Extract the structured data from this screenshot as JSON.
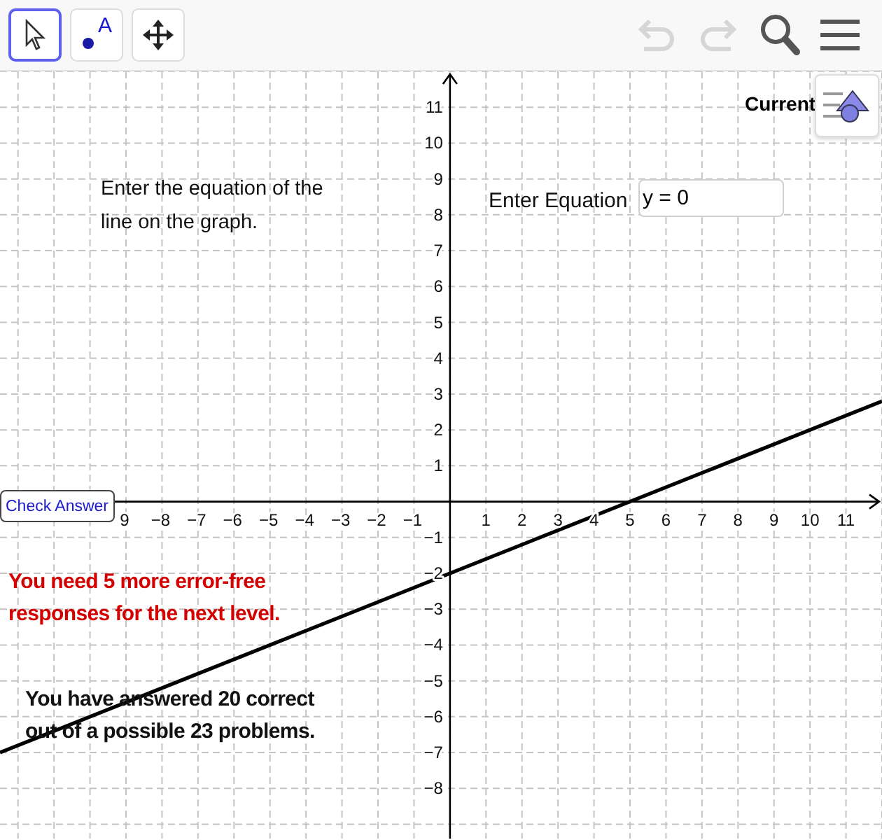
{
  "toolbar": {
    "tools": [
      {
        "kind": "pointer",
        "selected": true
      },
      {
        "kind": "point",
        "label": "A",
        "selected": false
      },
      {
        "kind": "move",
        "selected": false
      }
    ],
    "actions": [
      {
        "kind": "undo",
        "disabled": true
      },
      {
        "kind": "redo",
        "disabled": true
      },
      {
        "kind": "search",
        "disabled": false
      },
      {
        "kind": "menu",
        "disabled": false
      }
    ]
  },
  "graph": {
    "chart_data": {
      "type": "line",
      "grid": true,
      "x": [
        -12.5,
        12
      ],
      "series": [
        {
          "color": "#000000",
          "values": [
            -7,
            2.8
          ]
        }
      ],
      "xlim": [
        -12.5,
        12
      ],
      "ylim": [
        -9.4,
        12
      ],
      "xticks": [
        {
          "value": -9,
          "label": "9"
        },
        {
          "value": -8,
          "label": "−8"
        },
        {
          "value": -7,
          "label": "−7"
        },
        {
          "value": -6,
          "label": "−6"
        },
        {
          "value": -5,
          "label": "−5"
        },
        {
          "value": -4,
          "label": "−4"
        },
        {
          "value": -3,
          "label": "−3"
        },
        {
          "value": -2,
          "label": "−2"
        },
        {
          "value": -1,
          "label": "−1"
        },
        1,
        2,
        3,
        4,
        5,
        6,
        7,
        8,
        9,
        10,
        11
      ],
      "yticks": [
        {
          "value": -8,
          "label": "−8"
        },
        {
          "value": -7,
          "label": "−7"
        },
        {
          "value": -6,
          "label": "−6"
        },
        {
          "value": -5,
          "label": "−5"
        },
        {
          "value": -4,
          "label": "−4"
        },
        {
          "value": -3,
          "label": "−3"
        },
        {
          "value": -2,
          "label": "−2"
        },
        {
          "value": -1,
          "label": "−1"
        },
        1,
        2,
        3,
        4,
        5,
        6,
        7,
        8,
        9,
        10,
        11
      ]
    }
  },
  "instructions": [
    "Enter the equation of the",
    "line on the graph."
  ],
  "equation": {
    "label": "Enter Equation",
    "value": "y = 0"
  },
  "current_label": "Current",
  "check_button": "Check Answer",
  "level_message": [
    "You need 5 more error-free",
    "responses for the next level."
  ],
  "score_message": [
    "You have answered 20 correct",
    "out of a possible 23 problems."
  ]
}
